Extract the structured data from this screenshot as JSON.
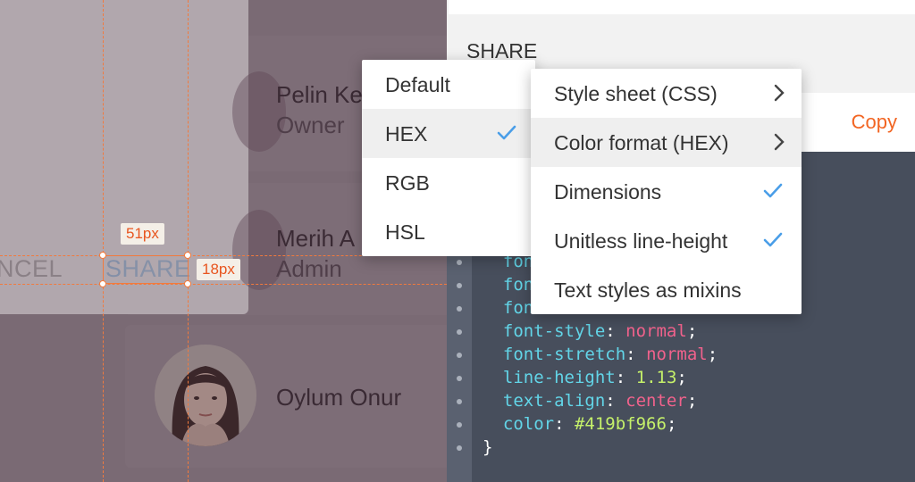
{
  "canvas": {
    "cancel_label": "NCEL",
    "share_label": "SHARE",
    "width_measure": "51px",
    "height_measure": "18px",
    "people": [
      {
        "name": "Pelin Ke",
        "role": "Owner"
      },
      {
        "name": "Merih A",
        "role": "Admin"
      },
      {
        "name": "Oylum Onur",
        "role": ""
      }
    ]
  },
  "panel": {
    "heading": "SHARE",
    "copy_label": "Copy",
    "code": {
      "partial_lines": [
        "fon",
        "fon",
        "fon"
      ],
      "lines": [
        {
          "prop": "font-style",
          "value": "normal",
          "kind": "kw"
        },
        {
          "prop": "font-stretch",
          "value": "normal",
          "kind": "kw"
        },
        {
          "prop": "line-height",
          "value": "1.13",
          "kind": "num"
        },
        {
          "prop": "text-align",
          "value": "center",
          "kind": "kw"
        },
        {
          "prop": "color",
          "value": "#419bf966",
          "kind": "num"
        }
      ],
      "closing_brace": "}"
    }
  },
  "format_menu": {
    "items": [
      {
        "label": "Default",
        "checked": false
      },
      {
        "label": "HEX",
        "checked": true
      },
      {
        "label": "RGB",
        "checked": false
      },
      {
        "label": "HSL",
        "checked": false
      }
    ]
  },
  "settings_menu": {
    "items": [
      {
        "label": "Style sheet (CSS)",
        "submenu": true,
        "checked": false
      },
      {
        "label": "Color format (HEX)",
        "submenu": true,
        "checked": false
      },
      {
        "label": "Dimensions",
        "submenu": false,
        "checked": true
      },
      {
        "label": "Unitless line-height",
        "submenu": false,
        "checked": true
      },
      {
        "label": "Text styles as mixins",
        "submenu": false,
        "checked": false
      }
    ]
  },
  "colors": {
    "accent": "#f26522",
    "check": "#4a9ee8",
    "guide": "#f27a3d"
  }
}
